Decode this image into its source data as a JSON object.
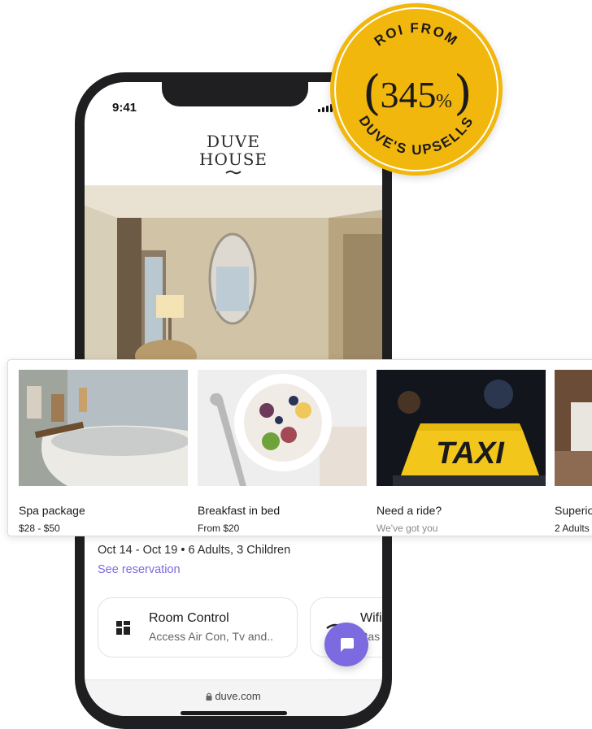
{
  "status_bar": {
    "time": "9:41"
  },
  "hotel": {
    "logo_line1": "DUVE",
    "logo_line2": "HOUSE"
  },
  "badge": {
    "top_text": "ROI FROM",
    "value": "345",
    "unit": "%",
    "bottom_text": "DUVE'S UPSELLS"
  },
  "upsells": [
    {
      "title": "Spa package",
      "price": "$28 - $50"
    },
    {
      "title": "Breakfast in bed",
      "price": "From $20"
    },
    {
      "title": "Need a ride?",
      "price": "We've got you",
      "taxi_sign": "TAXI"
    },
    {
      "title": "Superior",
      "price": "2 Adults"
    }
  ],
  "reservation": {
    "dates": "Oct 14 - Oct 19 • 6 Adults, 3 Children",
    "link": "See reservation"
  },
  "cards": [
    {
      "title": "Room Control",
      "subtitle": "Access Air Con, Tv and.."
    },
    {
      "title": "Wifi",
      "subtitle": "Pas"
    }
  ],
  "browser": {
    "url": "duve.com"
  },
  "colors": {
    "accent": "#7b6ae0",
    "badge": "#f2b70d",
    "phone_frame": "#1f1f22"
  }
}
